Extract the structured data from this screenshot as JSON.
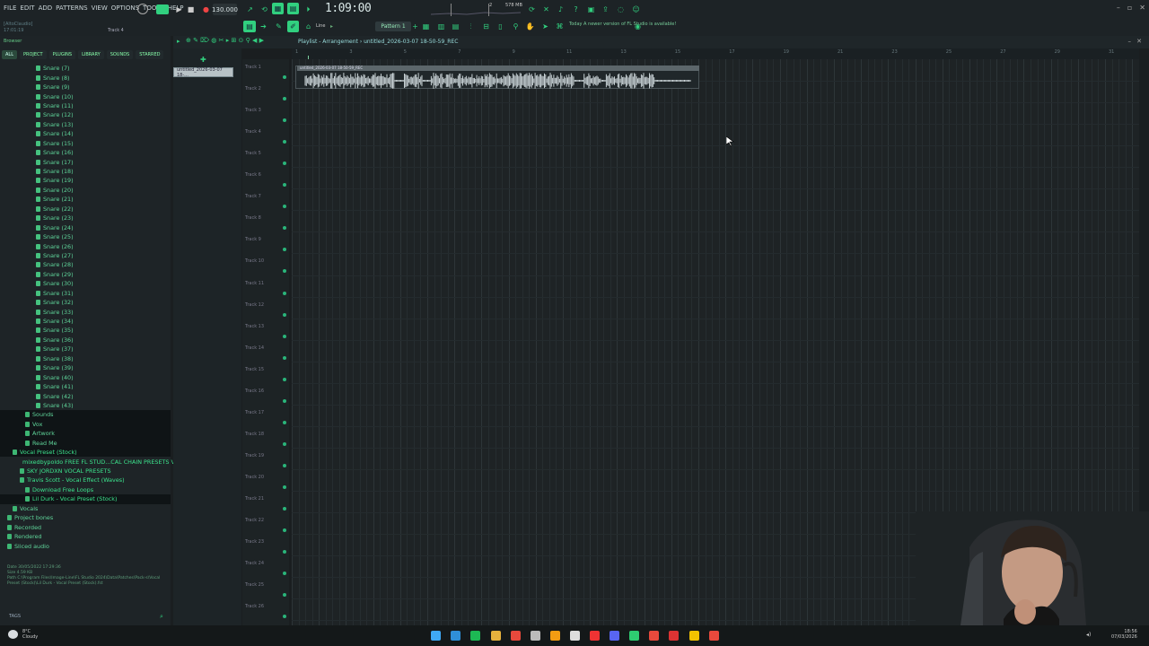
{
  "menu": [
    "FILE",
    "EDIT",
    "ADD",
    "PATTERNS",
    "VIEW",
    "OPTIONS",
    "TOOLS",
    "HELP"
  ],
  "hint_left": "[AltoClaudio]",
  "hint_time": "17:01:19",
  "current_track": "Track 4",
  "tempo": "130.000",
  "time_display": "1:09:00",
  "pattern": "Pattern 1",
  "memory": "578 MB",
  "cpu": "2",
  "notice": "Today  A newer version of FL Studio is available!",
  "snap": "Line",
  "playlist_title": "Playlist - Arrangement › untitled_2026-03-07 18-50-59_REC",
  "sidebar": {
    "header": "Browser",
    "tabs": [
      "ALL",
      "PROJECT",
      "PLUGINS",
      "LIBRARY",
      "SOUNDS",
      "STARRED"
    ],
    "snares": [
      "Snare (7)",
      "Snare (8)",
      "Snare (9)",
      "Snare (10)",
      "Snare (11)",
      "Snare (12)",
      "Snare (13)",
      "Snare (14)",
      "Snare (15)",
      "Snare (16)",
      "Snare (17)",
      "Snare (18)",
      "Snare (19)",
      "Snare (20)",
      "Snare (21)",
      "Snare (22)",
      "Snare (23)",
      "Snare (24)",
      "Snare (25)",
      "Snare (26)",
      "Snare (27)",
      "Snare (28)",
      "Snare (29)",
      "Snare (30)",
      "Snare (31)",
      "Snare (32)",
      "Snare (33)",
      "Snare (34)",
      "Snare (35)",
      "Snare (36)",
      "Snare (37)",
      "Snare (38)",
      "Snare (39)",
      "Snare (40)",
      "Snare (41)",
      "Snare (42)",
      "Snare (43)"
    ],
    "folders": [
      {
        "label": "Sounds",
        "indent": 28
      },
      {
        "label": "Vox",
        "indent": 28
      },
      {
        "label": "Artwork",
        "indent": 28
      },
      {
        "label": "Read Me",
        "indent": 28
      },
      {
        "label": "Vocal Preset (Stock)",
        "indent": 14
      },
      {
        "label": "mixedbypoldo FREE FL STUD...CAL CHAIN PRESETS VOL. 2",
        "indent": 22
      },
      {
        "label": "SKY JORDXN VOCAL PRESETS",
        "indent": 22
      },
      {
        "label": "Travis Scott - Vocal Effect (Waves)",
        "indent": 22
      },
      {
        "label": "Download Free Loops",
        "indent": 28
      },
      {
        "label": "Lil Durk - Vocal Preset (Stock)",
        "indent": 28
      },
      {
        "label": "Vocals",
        "indent": 14
      },
      {
        "label": "Project bones",
        "indent": 8
      },
      {
        "label": "Recorded",
        "indent": 8
      },
      {
        "label": "Rendered",
        "indent": 8
      },
      {
        "label": "Sliced audio",
        "indent": 8
      }
    ],
    "info_date": "Date   30/05/2022 17:29:36",
    "info_size": "Size   4.59 KB",
    "info_path": "Path   C:\\Program Files\\Image-Line\\FL Studio 2024\\Data\\Patches\\Pack-s\\Vocal Preset (Stock)\\Lil Durk - Vocal Preset (Stock).fst",
    "tags": "TAGS"
  },
  "channel_item": "untitled_2026-03-07 18-...",
  "clip_title": "untitled_2026-03-07 18-50-59_REC",
  "tracks": [
    "Track 1",
    "Track 2",
    "Track 3",
    "Track 4",
    "Track 5",
    "Track 6",
    "Track 7",
    "Track 8",
    "Track 9",
    "Track 10",
    "Track 11",
    "Track 12",
    "Track 13",
    "Track 14",
    "Track 15",
    "Track 16",
    "Track 17",
    "Track 18",
    "Track 19",
    "Track 20",
    "Track 21",
    "Track 22",
    "Track 23",
    "Track 24",
    "Track 25",
    "Track 26"
  ],
  "ruler": [
    "1",
    "",
    "3",
    "",
    "5",
    "",
    "7",
    "",
    "9",
    "",
    "11",
    "",
    "13",
    "",
    "15",
    "",
    "17",
    "",
    "19",
    "",
    "21",
    "",
    "23",
    "",
    "25",
    "",
    "27",
    "",
    "29",
    "",
    "31"
  ],
  "weather_temp": "8°C",
  "weather_desc": "Cloudy",
  "clock_time": "18:56",
  "clock_date": "07/03/2026",
  "colors": {
    "accent": "#31d07f",
    "bg": "#1e2325",
    "tree": "#5fd59a"
  }
}
